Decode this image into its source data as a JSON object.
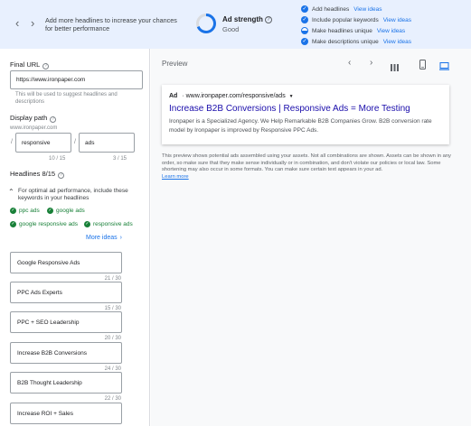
{
  "banner": {
    "message": "Add more headlines to increase your chances for better performance",
    "strength_title": "Ad strength",
    "strength_value": "Good",
    "tips": [
      {
        "label": "Add headlines",
        "link": "View ideas",
        "state": "done"
      },
      {
        "label": "Include popular keywords",
        "link": "View ideas",
        "state": "done"
      },
      {
        "label": "Make headlines unique",
        "link": "View ideas",
        "state": "partial"
      },
      {
        "label": "Make descriptions unique",
        "link": "View ideas",
        "state": "done"
      }
    ],
    "colors": {
      "accent": "#1a73e8",
      "background": "#e8f0fe"
    }
  },
  "final_url": {
    "label": "Final URL",
    "value": "https://www.ironpaper.com",
    "hint": "This will be used to suggest headlines and descriptions"
  },
  "display_path": {
    "label": "Display path",
    "domain": "www.ironpaper.com",
    "path1": "responsive",
    "path2": "ads",
    "count1": "10 / 15",
    "count2": "3 / 15"
  },
  "headlines": {
    "label": "Headlines 8/15",
    "recommendation": "For optimal ad performance, include these keywords in your headlines",
    "keywords": [
      "ppc ads",
      "google ads",
      "google responsive ads",
      "responsive ads"
    ],
    "more_ideas": "More ideas",
    "items": [
      {
        "text": "Google Responsive Ads",
        "count": "21 / 30"
      },
      {
        "text": "PPC Ads Experts",
        "count": "15 / 30"
      },
      {
        "text": "PPC + SEO Leadership",
        "count": "20 / 30"
      },
      {
        "text": "Increase B2B Conversions",
        "count": "24 / 30"
      },
      {
        "text": "B2B Thought Leadership",
        "count": "22 / 30"
      },
      {
        "text": "Increase ROI + Sales",
        "count": ""
      }
    ]
  },
  "preview": {
    "title": "Preview",
    "ad_badge": "Ad",
    "display_url": "www.ironpaper.com/responsive/ads",
    "headline": "Increase B2B Conversions | Responsive Ads = More Testing",
    "description": "Ironpaper is a Specialized Agency. We Help Remarkable B2B Companies Grow. B2B conversion rate model by Ironpaper is improved by Responsive PPC Ads.",
    "disclaimer": "This preview shows potential ads assembled using your assets. Not all combinations are shown. Assets can be shown in any order, so make sure that they make sense individually or in combination, and don't violate our policies or local law. Some shortening may also occur in some formats. You can make sure certain text appears in your ad.",
    "learn_more": "Learn more",
    "colors": {
      "headline": "#1a0dab",
      "link": "#1a73e8"
    }
  }
}
